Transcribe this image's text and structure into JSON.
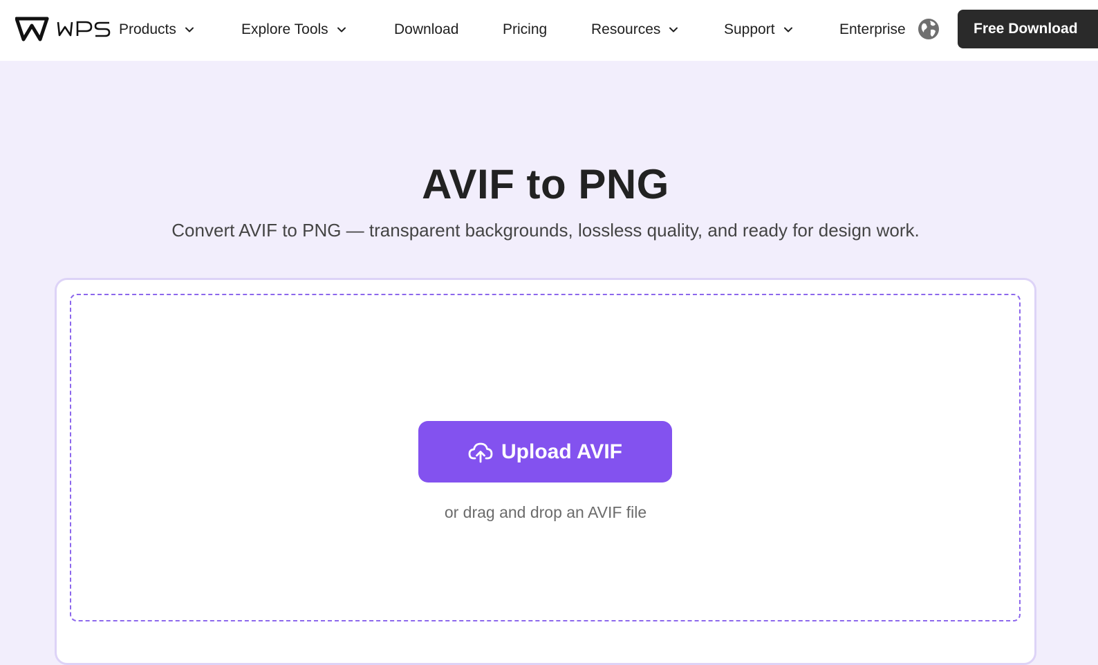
{
  "header": {
    "logo_text": "WPS",
    "nav": [
      {
        "label": "Products",
        "has_dropdown": true
      },
      {
        "label": "Explore Tools",
        "has_dropdown": true
      },
      {
        "label": "Download",
        "has_dropdown": false
      },
      {
        "label": "Pricing",
        "has_dropdown": false
      },
      {
        "label": "Resources",
        "has_dropdown": true
      },
      {
        "label": "Support",
        "has_dropdown": true
      },
      {
        "label": "Enterprise",
        "has_dropdown": false
      }
    ],
    "language_icon": "globe-icon",
    "cta_label": "Free Download"
  },
  "hero": {
    "title": "AVIF to PNG",
    "subtitle": "Convert AVIF to PNG — transparent backgrounds, lossless quality, and ready for design work."
  },
  "upload": {
    "button_icon": "cloud-upload-icon",
    "button_label": "Upload AVIF",
    "drag_text": "or drag and drop an AVIF file"
  },
  "colors": {
    "page_background": "#f2eefc",
    "accent": "#8352ef",
    "cta_background": "#2a2a2a",
    "dashed_border": "#8c67ec"
  }
}
